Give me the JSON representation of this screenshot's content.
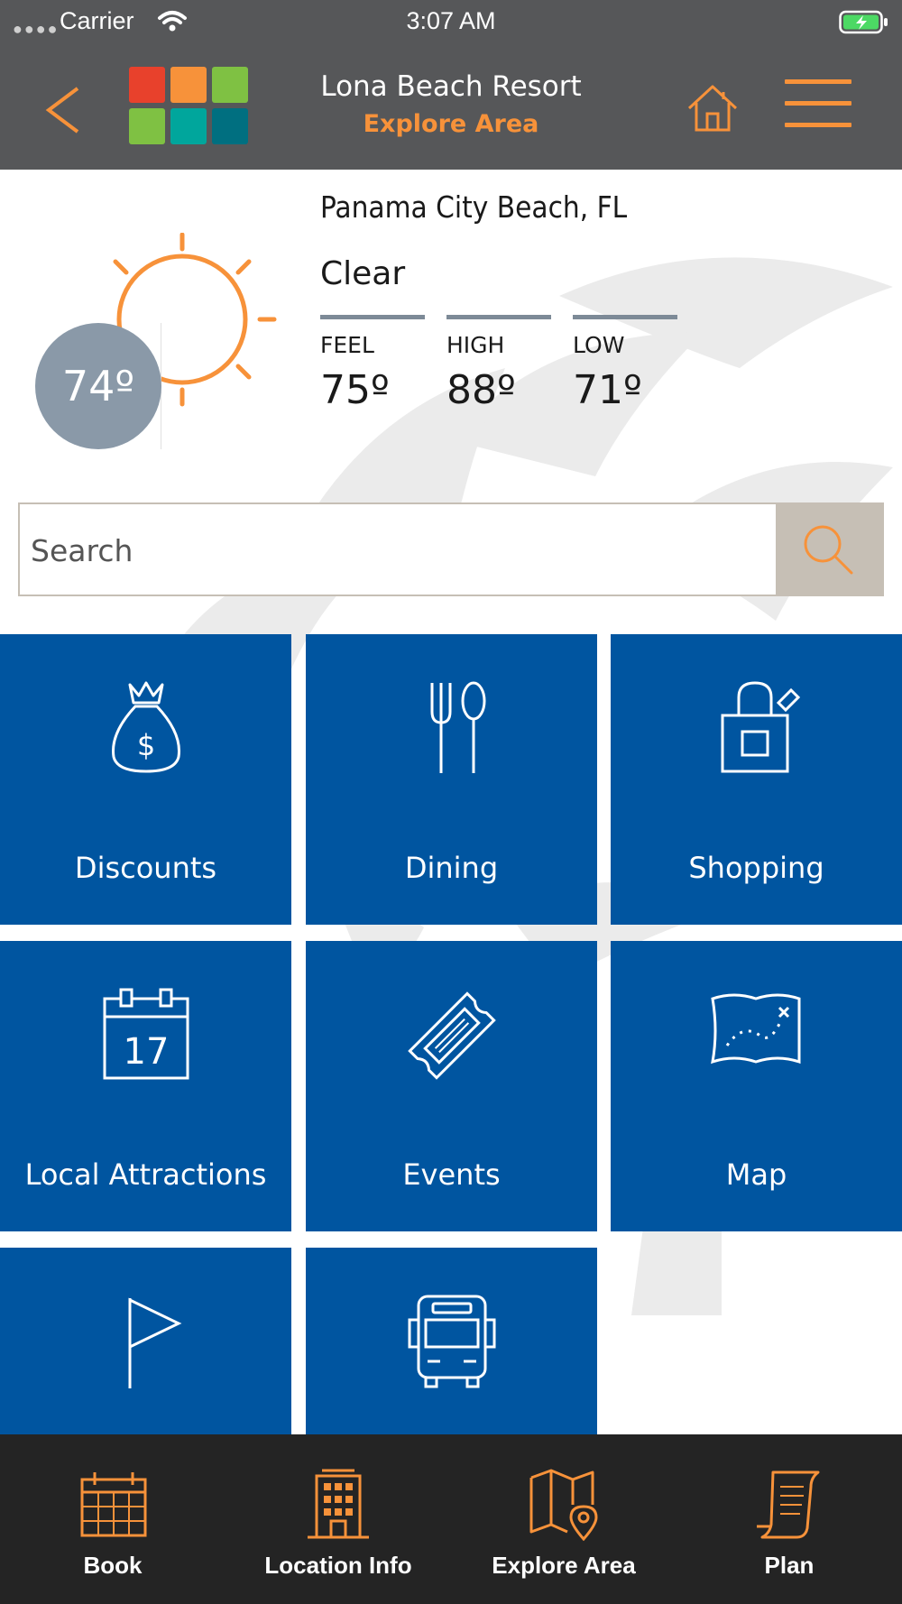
{
  "status_bar": {
    "carrier": "Carrier",
    "time": "3:07 AM",
    "signal_icon": "signal-dots-icon",
    "wifi_icon": "wifi-icon",
    "battery_icon": "battery-charging-icon"
  },
  "header": {
    "title": "Lona Beach Resort",
    "subtitle": "Explore Area",
    "accent_color": "#f7923a",
    "background_color": "#565759",
    "logo_colors": [
      "#e8412c",
      "#f7923a",
      "#7fc143",
      "#7fc143",
      "#00a69c",
      "#006f80"
    ]
  },
  "weather": {
    "location": "Panama City Beach, FL",
    "condition": "Clear",
    "current_temp": "74º",
    "feel_label": "FEEL",
    "feel_value": "75º",
    "high_label": "HIGH",
    "high_value": "88º",
    "low_label": "LOW",
    "low_value": "71º",
    "icon": "sun-icon"
  },
  "search": {
    "placeholder": "Search",
    "value": ""
  },
  "tiles": [
    {
      "label": "Discounts",
      "icon": "money-bag-icon"
    },
    {
      "label": "Dining",
      "icon": "fork-spoon-icon"
    },
    {
      "label": "Shopping",
      "icon": "shopping-bag-icon"
    },
    {
      "label": "Local Attractions",
      "icon": "calendar-icon"
    },
    {
      "label": "Events",
      "icon": "ticket-icon"
    },
    {
      "label": "Map",
      "icon": "treasure-map-icon"
    },
    {
      "label": "",
      "icon": "flag-icon"
    },
    {
      "label": "",
      "icon": "bus-icon"
    }
  ],
  "tile_color": "#0055a0",
  "bottom_nav": [
    {
      "label": "Book",
      "icon": "calendar-grid-icon"
    },
    {
      "label": "Location Info",
      "icon": "building-icon"
    },
    {
      "label": "Explore Area",
      "icon": "map-pin-icon"
    },
    {
      "label": "Plan",
      "icon": "scroll-icon"
    }
  ]
}
